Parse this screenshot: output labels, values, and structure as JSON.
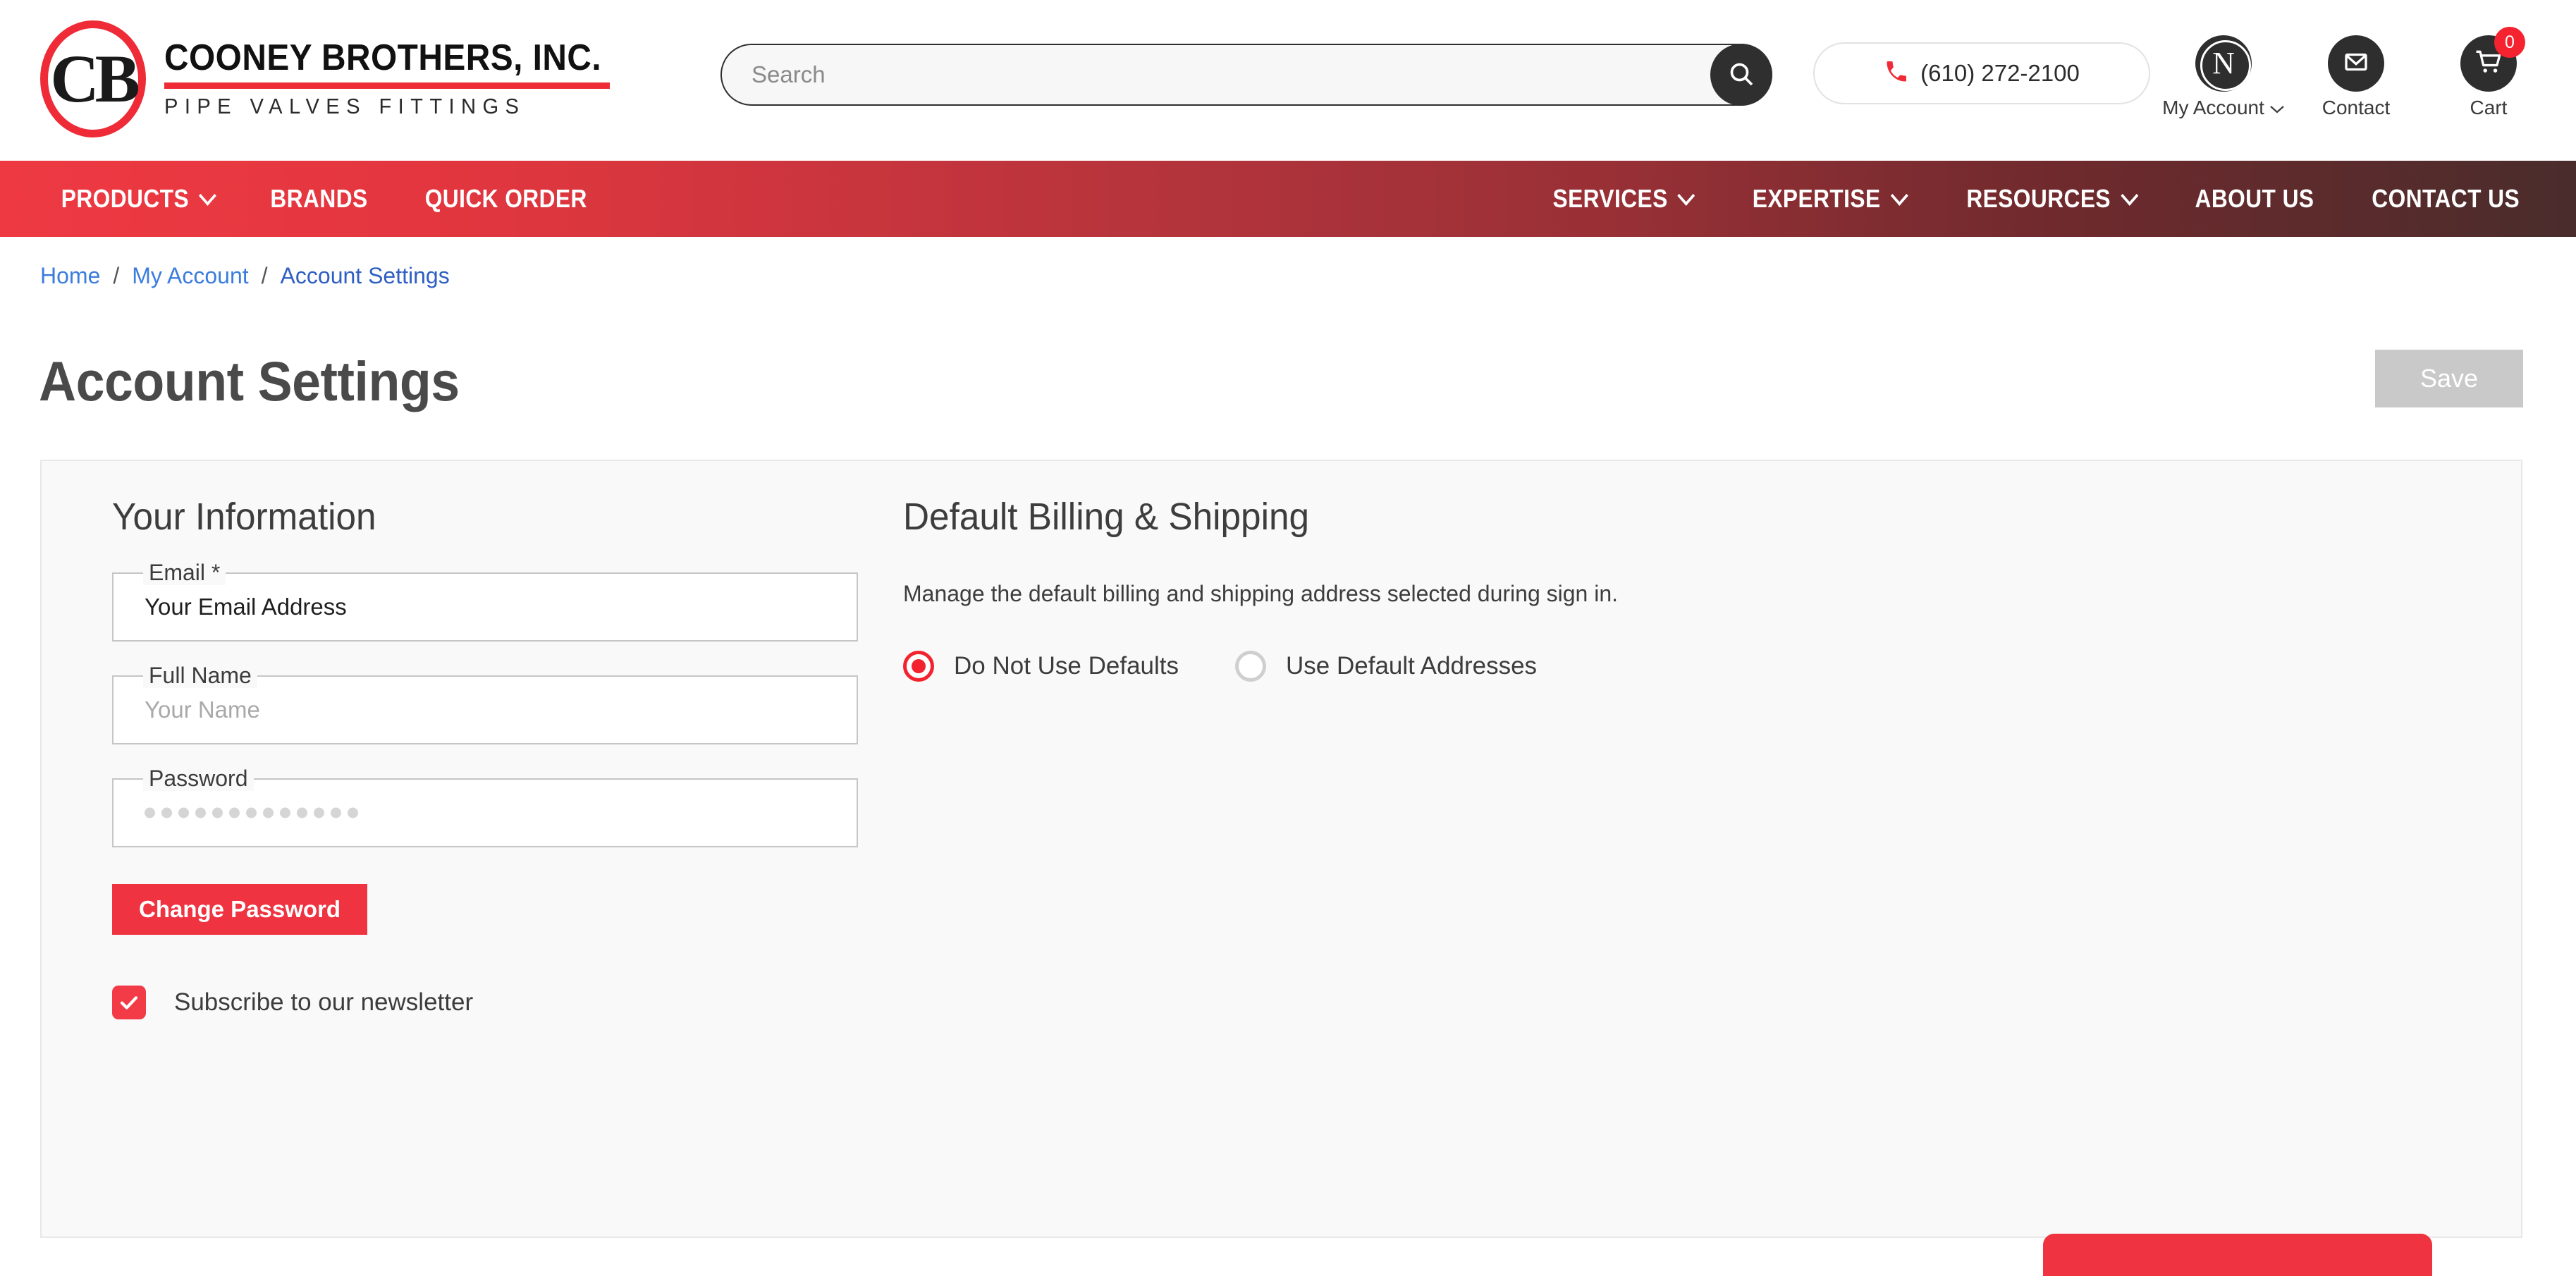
{
  "brand": {
    "monogram": "CB",
    "name": "COONEY BROTHERS, INC.",
    "tagline": "PIPE VALVES FITTINGS"
  },
  "header": {
    "search": {
      "placeholder": "Search",
      "value": "",
      "icon": "search-icon"
    },
    "phone": {
      "number": "(610) 272-2100",
      "icon": "phone-icon"
    },
    "account": {
      "avatar_letter": "N",
      "label": "My Account",
      "caret": "⌄"
    },
    "contact": {
      "label": "Contact",
      "icon": "mail-icon"
    },
    "cart": {
      "label": "Cart",
      "count": "0",
      "icon": "cart-icon"
    }
  },
  "nav": {
    "left": [
      {
        "label": "PRODUCTS",
        "has_dropdown": true
      },
      {
        "label": "BRANDS",
        "has_dropdown": false
      },
      {
        "label": "QUICK ORDER",
        "has_dropdown": false
      }
    ],
    "right": [
      {
        "label": "SERVICES",
        "has_dropdown": true
      },
      {
        "label": "EXPERTISE",
        "has_dropdown": true
      },
      {
        "label": "RESOURCES",
        "has_dropdown": true
      },
      {
        "label": "ABOUT US",
        "has_dropdown": false
      },
      {
        "label": "CONTACT US",
        "has_dropdown": false
      }
    ]
  },
  "breadcrumb": {
    "items": [
      "Home",
      "My Account",
      "Account Settings"
    ],
    "separator": "/"
  },
  "page": {
    "title": "Account Settings",
    "save_label": "Save",
    "save_disabled": true
  },
  "your_information": {
    "title": "Your Information",
    "email": {
      "label": "Email",
      "required_mark": "*",
      "value": "Your Email Address",
      "is_placeholder": false
    },
    "full_name": {
      "label": "Full Name",
      "value": "Your Name",
      "is_placeholder": true
    },
    "password": {
      "label": "Password",
      "masked_dots": 13
    },
    "change_password_label": "Change Password",
    "newsletter": {
      "label": "Subscribe to our newsletter",
      "checked": true
    }
  },
  "default_billing_shipping": {
    "title": "Default Billing & Shipping",
    "description": "Manage the default billing and shipping address selected during sign in.",
    "options": [
      {
        "label": "Do Not Use Defaults",
        "selected": true
      },
      {
        "label": "Use Default Addresses",
        "selected": false
      }
    ]
  },
  "colors": {
    "brand_red": "#ef3340",
    "nav_red_start": "#ee3942",
    "nav_red_end": "#4a2c2c",
    "link_blue": "#3b7ddd",
    "disabled_gray": "#c9c9c9"
  }
}
